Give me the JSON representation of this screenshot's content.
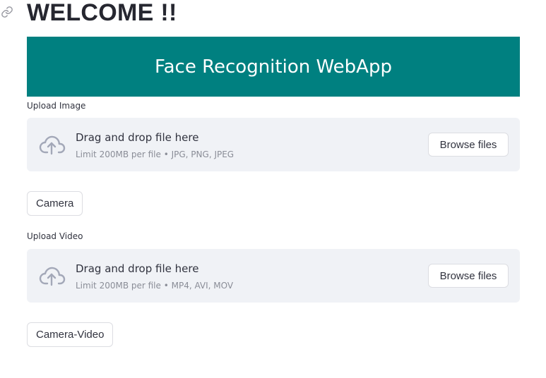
{
  "header": {
    "title": "WELCOME !!"
  },
  "banner": {
    "text": "Face Recognition WebApp",
    "background": "#008080"
  },
  "image_upload": {
    "label": "Upload Image",
    "drop_text": "Drag and drop file here",
    "limit_text": "Limit 200MB per file • JPG, PNG, JPEG",
    "browse_label": "Browse files"
  },
  "camera_button": {
    "label": "Camera"
  },
  "video_upload": {
    "label": "Upload Video",
    "drop_text": "Drag and drop file here",
    "limit_text": "Limit 200MB per file • MP4, AVI, MOV",
    "browse_label": "Browse files"
  },
  "camera_video_button": {
    "label": "Camera-Video"
  },
  "icons": {
    "anchor": "link-icon",
    "upload": "cloud-upload-icon"
  }
}
